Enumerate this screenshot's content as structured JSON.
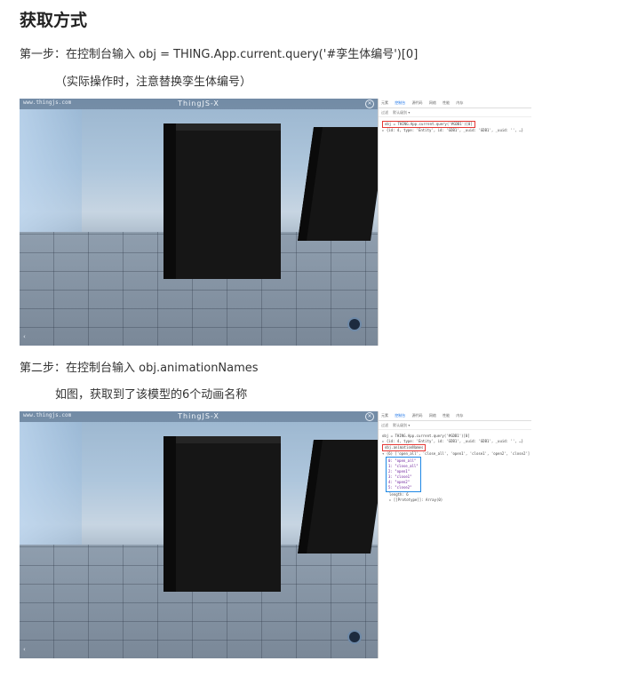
{
  "heading": "获取方式",
  "step1": {
    "text": "第一步：在控制台输入   obj = THING.App.current.query('#孪生体编号')[0]",
    "note": "（实际操作时，注意替换孪生体编号）"
  },
  "step2": {
    "text": "第二步：在控制台输入  obj.animationNames",
    "note": "如图，获取到了该模型的6个动画名称"
  },
  "viewport": {
    "url": "www.thingjs.com",
    "title": "ThingJS-X"
  },
  "devtools": {
    "tabs": [
      "元素",
      "控制台",
      "源代码",
      "网络",
      "性能",
      "内存"
    ],
    "active_tab": "控制台",
    "filter_placeholder": "过滤",
    "levels": "默认级别 ▾",
    "query_cmd": "obj = THING.App.current.query('#GDB1')[0]",
    "query_result": "▸ {id: 4, type: 'Entity', id: 'GDB1', _uuid: 'GDB1', _uuid: '', …}",
    "anim_cmd": "obj.animationNames",
    "anim_result": "▾ (6) ['open_all', 'close_all', 'open1', 'close1', 'open2', 'close2']",
    "anim_items": [
      "0: \"open_all\"",
      "1: \"close_all\"",
      "2: \"open1\"",
      "3: \"close1\"",
      "4: \"open2\"",
      "5: \"close2\""
    ],
    "length": "length: 6",
    "prototype": "▸ [[Prototype]]: Array(0)"
  },
  "colors": {
    "annotation_red": "#e53935",
    "annotation_blue": "#1e88e5",
    "devtools_active": "#1a73e8"
  }
}
